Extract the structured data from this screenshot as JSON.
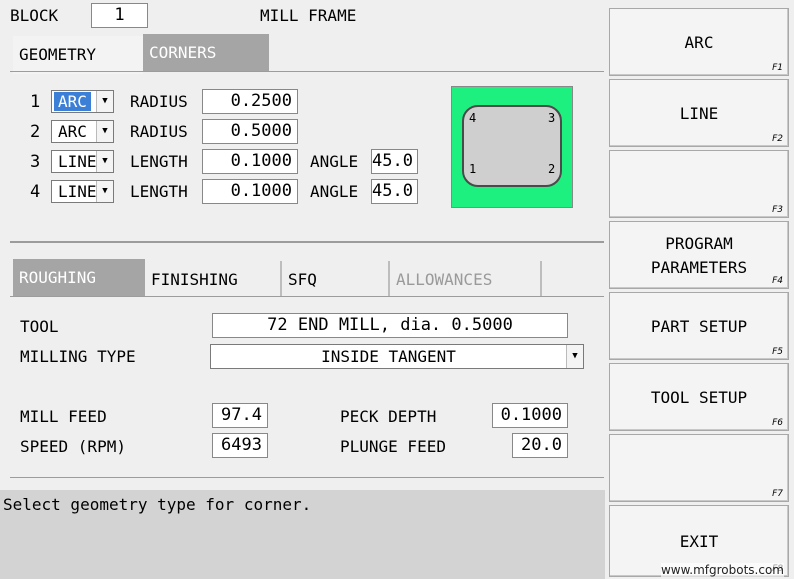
{
  "header": {
    "block_label": "BLOCK",
    "block_value": "1",
    "title": "MILL FRAME"
  },
  "top_tabs": {
    "geometry": "GEOMETRY",
    "corners": "CORNERS"
  },
  "corners": [
    {
      "num": "1",
      "type": "ARC",
      "param_label": "RADIUS",
      "param_value": "0.2500",
      "angle_label": "",
      "angle_value": ""
    },
    {
      "num": "2",
      "type": "ARC",
      "param_label": "RADIUS",
      "param_value": "0.5000",
      "angle_label": "",
      "angle_value": ""
    },
    {
      "num": "3",
      "type": "LINE",
      "param_label": "LENGTH",
      "param_value": "0.1000",
      "angle_label": "ANGLE",
      "angle_value": "45.0"
    },
    {
      "num": "4",
      "type": "LINE",
      "param_label": "LENGTH",
      "param_value": "0.1000",
      "angle_label": "ANGLE",
      "angle_value": "45.0"
    }
  ],
  "preview": {
    "corner_labels": {
      "tl": "4",
      "tr": "3",
      "bl": "1",
      "br": "2"
    }
  },
  "bottom_tabs": {
    "roughing": "ROUGHING",
    "finishing": "FINISHING",
    "sfq": "SFQ",
    "allowances": "ALLOWANCES"
  },
  "roughing": {
    "tool_label": "TOOL",
    "tool_value": "72 END MILL, dia. 0.5000",
    "milling_type_label": "MILLING TYPE",
    "milling_type_value": "INSIDE TANGENT",
    "mill_feed_label": "MILL FEED",
    "mill_feed_value": "97.4",
    "speed_label": "SPEED (RPM)",
    "speed_value": "6493",
    "peck_depth_label": "PECK DEPTH",
    "peck_depth_value": "0.1000",
    "plunge_feed_label": "PLUNGE FEED",
    "plunge_feed_value": "20.0"
  },
  "status": {
    "message": "Select geometry type for corner."
  },
  "function_keys": [
    {
      "label1": "ARC",
      "label2": "",
      "key": "F1"
    },
    {
      "label1": "LINE",
      "label2": "",
      "key": "F2"
    },
    {
      "label1": "",
      "label2": "",
      "key": "F3"
    },
    {
      "label1": "PROGRAM",
      "label2": "PARAMETERS",
      "key": "F4"
    },
    {
      "label1": "PART SETUP",
      "label2": "",
      "key": "F5"
    },
    {
      "label1": "TOOL SETUP",
      "label2": "",
      "key": "F6"
    },
    {
      "label1": "",
      "label2": "",
      "key": "F7"
    },
    {
      "label1": "EXIT",
      "label2": "",
      "key": "F8"
    }
  ],
  "watermark": "www.mfgrobots.com",
  "colors": {
    "preview_bg": "#1df07f",
    "tab_inactive": "#a5a5a5",
    "selection": "#3c7fd6",
    "status_bg": "#d3d3d3"
  }
}
